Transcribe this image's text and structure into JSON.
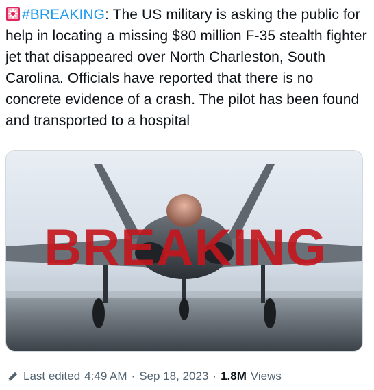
{
  "tweet": {
    "hashtag": "#BREAKING",
    "body": ": The US military is asking the public for help in locating a missing $80 million F-35 stealth fighter jet that disappeared over North Charleston, South Carolina. Officials have reported that there is no concrete evidence of a crash. The pilot has been found and transported to a hospital"
  },
  "media": {
    "overlay_text": "BREAKING",
    "overlay_color": "#c4161c"
  },
  "meta": {
    "edited_label": "Last edited",
    "time": "4:49 AM",
    "separator": "·",
    "date": "Sep 18, 2023",
    "views_count": "1.8M",
    "views_label": "Views"
  },
  "icons": {
    "siren": "police-light-icon",
    "edit": "pencil-icon"
  }
}
